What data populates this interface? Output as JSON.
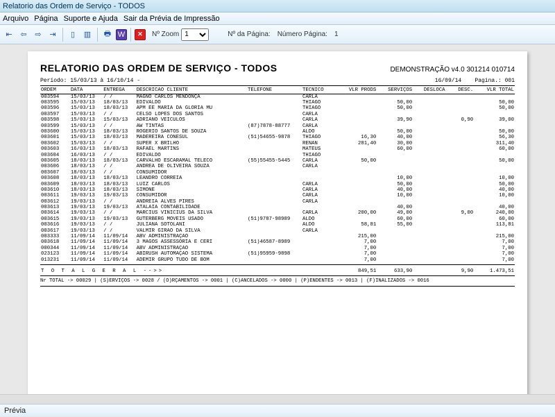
{
  "window": {
    "title": "Relatorio das Ordem de Serviço - TODOS"
  },
  "menu": {
    "items": [
      "Arquivo",
      "Página",
      "Suporte e Ajuda",
      "Sair da Prévia de Impressão"
    ]
  },
  "toolbar": {
    "zoom_label": "Nº Zoom",
    "zoom_value": "1",
    "page_label": "Nº da Página:",
    "page_field_label": "Número Página:",
    "page_value": "1"
  },
  "report": {
    "title": "RELATORIO DAS ORDEM DE SERVIÇO  - TODOS",
    "version": "DEMONSTRAÇÃO v4.0 301214 010714",
    "period_label": "Período: 15/03/13 à 16/10/14 -",
    "print_date": "16/09/14",
    "page_label": "Pagina.: 001",
    "columns": [
      "ORDEM",
      "DATA",
      "ENTREGA",
      "DESCRICAO CLIENTE",
      "TELEFONE",
      "TÉCNICO",
      "VLR PRODS",
      "SERVIÇOS",
      "DESLOCA",
      "DESC.",
      "VLR TOTAL"
    ],
    "rows": [
      {
        "ordem": "003594",
        "data": "15/03/13",
        "entrega": "  /  /",
        "cliente": "MAGNO CARLOS MENDONÇA",
        "telefone": "",
        "tecnico": "CARLA",
        "prods": "",
        "serv": "",
        "desl": "",
        "desc": "",
        "tot": ""
      },
      {
        "ordem": "003595",
        "data": "15/03/13",
        "entrega": "18/03/13",
        "cliente": "EDIVALDO",
        "telefone": "",
        "tecnico": "THIAGO",
        "prods": "",
        "serv": "50,00",
        "desl": "",
        "desc": "",
        "tot": "50,00"
      },
      {
        "ordem": "003596",
        "data": "15/03/13",
        "entrega": "18/03/13",
        "cliente": "APM EE MARIA DA GLORIA MU",
        "telefone": "",
        "tecnico": "THIAGO",
        "prods": "",
        "serv": "50,00",
        "desl": "",
        "desc": "",
        "tot": "50,00"
      },
      {
        "ordem": "003597",
        "data": "15/03/13",
        "entrega": "  /  /",
        "cliente": "CELSO LOPES DOS SANTOS",
        "telefone": "",
        "tecnico": "CARLA",
        "prods": "",
        "serv": "",
        "desl": "",
        "desc": "",
        "tot": ""
      },
      {
        "ordem": "003598",
        "data": "15/03/13",
        "entrega": "15/03/13",
        "cliente": "ADRIANO VEICULOS",
        "telefone": "",
        "tecnico": "CARLA",
        "prods": "",
        "serv": "39,90",
        "desl": "",
        "desc": "0,90",
        "tot": "39,00"
      },
      {
        "ordem": "003599",
        "data": "15/03/13",
        "entrega": "  /  /",
        "cliente": "AW TINTAS",
        "telefone": "(87)7878-88777",
        "tecnico": "CARLA",
        "prods": "",
        "serv": "",
        "desl": "",
        "desc": "",
        "tot": ""
      },
      {
        "ordem": "003600",
        "data": "15/03/13",
        "entrega": "18/03/13",
        "cliente": "ROGERIO SANTOS DE SOUZA",
        "telefone": "",
        "tecnico": "ALDO",
        "prods": "",
        "serv": "50,00",
        "desl": "",
        "desc": "",
        "tot": "50,00"
      },
      {
        "ordem": "003601",
        "data": "15/03/13",
        "entrega": "18/03/13",
        "cliente": "MADEREIRA  CONESUL",
        "telefone": "(51)54655-9878",
        "tecnico": "THIAGO",
        "prods": "16,30",
        "serv": "40,00",
        "desl": "",
        "desc": "",
        "tot": "56,30"
      },
      {
        "ordem": "003602",
        "data": "15/03/13",
        "entrega": "  /  /",
        "cliente": "SUPER X BRILHO",
        "telefone": "",
        "tecnico": "RENAN",
        "prods": "281,40",
        "serv": "30,00",
        "desl": "",
        "desc": "",
        "tot": "311,40"
      },
      {
        "ordem": "003603",
        "data": "16/03/13",
        "entrega": "18/03/13",
        "cliente": "RAFAEL MARTINS",
        "telefone": "",
        "tecnico": "MATEUS",
        "prods": "",
        "serv": "60,00",
        "desl": "",
        "desc": "",
        "tot": "60,00"
      },
      {
        "ordem": "003604",
        "data": "16/03/13",
        "entrega": "  /  /",
        "cliente": "EDIVALDO",
        "telefone": "",
        "tecnico": "THIAGO",
        "prods": "",
        "serv": "",
        "desl": "",
        "desc": "",
        "tot": ""
      },
      {
        "ordem": "003605",
        "data": "18/03/13",
        "entrega": "18/03/13",
        "cliente": "CARVALHO ESCARAMAL TELECO",
        "telefone": "(55)55455-5445",
        "tecnico": "CARLA",
        "prods": "50,00",
        "serv": "",
        "desl": "",
        "desc": "",
        "tot": "50,00"
      },
      {
        "ordem": "003606",
        "data": "18/03/13",
        "entrega": "  /  /",
        "cliente": "ANDREA DE OLIVEIRA SOUZA",
        "telefone": "",
        "tecnico": "CARLA",
        "prods": "",
        "serv": "",
        "desl": "",
        "desc": "",
        "tot": ""
      },
      {
        "ordem": "003607",
        "data": "18/03/13",
        "entrega": "  /  /",
        "cliente": "CONSUMIDOR",
        "telefone": "",
        "tecnico": "",
        "prods": "",
        "serv": "",
        "desl": "",
        "desc": "",
        "tot": ""
      },
      {
        "ordem": "003608",
        "data": "18/03/13",
        "entrega": "18/03/13",
        "cliente": "LEANDRO CORREIA",
        "telefone": "",
        "tecnico": "",
        "prods": "",
        "serv": "10,00",
        "desl": "",
        "desc": "",
        "tot": "10,00"
      },
      {
        "ordem": "003609",
        "data": "18/03/13",
        "entrega": "18/03/13",
        "cliente": "LUIZ CARLOS",
        "telefone": "",
        "tecnico": "CARLA",
        "prods": "",
        "serv": "50,00",
        "desl": "",
        "desc": "",
        "tot": "50,00"
      },
      {
        "ordem": "003610",
        "data": "18/03/13",
        "entrega": "18/03/13",
        "cliente": "SIMONE",
        "telefone": "",
        "tecnico": "CARLA",
        "prods": "",
        "serv": "40,00",
        "desl": "",
        "desc": "",
        "tot": "40,00"
      },
      {
        "ordem": "003611",
        "data": "19/03/13",
        "entrega": "19/03/13",
        "cliente": "CONSUMIDOR",
        "telefone": "",
        "tecnico": "CARLA",
        "prods": "",
        "serv": "10,00",
        "desl": "",
        "desc": "",
        "tot": "10,00"
      },
      {
        "ordem": "003612",
        "data": "19/03/13",
        "entrega": "  /  /",
        "cliente": "ANDREIA ALVES PIRES",
        "telefone": "",
        "tecnico": "CARLA",
        "prods": "",
        "serv": "",
        "desl": "",
        "desc": "",
        "tot": ""
      },
      {
        "ordem": "003613",
        "data": "19/03/13",
        "entrega": "19/03/13",
        "cliente": "ATALAIA CONTABILIDADE",
        "telefone": "",
        "tecnico": "",
        "prods": "",
        "serv": "40,00",
        "desl": "",
        "desc": "",
        "tot": "40,00"
      },
      {
        "ordem": "003614",
        "data": "19/03/13",
        "entrega": "  /  /",
        "cliente": "MARCIUS VINICIUS DA SILVA",
        "telefone": "",
        "tecnico": "CARLA",
        "prods": "200,00",
        "serv": "49,00",
        "desl": "",
        "desc": "9,00",
        "tot": "240,00"
      },
      {
        "ordem": "003615",
        "data": "19/03/13",
        "entrega": "19/03/13",
        "cliente": "GUTERBERG MOVEIS USADO",
        "telefone": "(51)9787-98989",
        "tecnico": "ALDO",
        "prods": "",
        "serv": "60,00",
        "desl": "",
        "desc": "",
        "tot": "60,00"
      },
      {
        "ordem": "003616",
        "data": "19/03/13",
        "entrega": "  /  /",
        "cliente": "JULIANA SOTOLANI",
        "telefone": "",
        "tecnico": "ALDO",
        "prods": "58,81",
        "serv": "55,00",
        "desl": "",
        "desc": "",
        "tot": "113,81"
      },
      {
        "ordem": "003617",
        "data": "19/03/13",
        "entrega": "  /  /",
        "cliente": "VALMIR GIRAO DA SILVA",
        "telefone": "",
        "tecnico": "CARLA",
        "prods": "",
        "serv": "",
        "desl": "",
        "desc": "",
        "tot": ""
      },
      {
        "ordem": "003333",
        "data": "11/09/14",
        "entrega": "11/09/14",
        "cliente": "ABV ADMINISTRAÇÃO",
        "telefone": "",
        "tecnico": "",
        "prods": "215,00",
        "serv": "",
        "desl": "",
        "desc": "",
        "tot": "215,00"
      },
      {
        "ordem": "003618",
        "data": "11/09/14",
        "entrega": "11/09/14",
        "cliente": "3 MAGOS ASSESSORIA E CERI",
        "telefone": "(51)46587-8989",
        "tecnico": "",
        "prods": "7,00",
        "serv": "",
        "desl": "",
        "desc": "",
        "tot": "7,00"
      },
      {
        "ordem": "000344",
        "data": "11/09/14",
        "entrega": "11/09/14",
        "cliente": "ABV ADMINISTRAÇÃO",
        "telefone": "",
        "tecnico": "",
        "prods": "7,00",
        "serv": "",
        "desl": "",
        "desc": "",
        "tot": "7,00"
      },
      {
        "ordem": "023123",
        "data": "11/09/14",
        "entrega": "11/09/14",
        "cliente": "ABIRUSH AUTOMAÇÃO SISTEMA",
        "telefone": "(51)95959-9898",
        "tecnico": "",
        "prods": "7,00",
        "serv": "",
        "desl": "",
        "desc": "",
        "tot": "7,00"
      },
      {
        "ordem": "013231",
        "data": "11/09/14",
        "entrega": "11/09/14",
        "cliente": "ADEMIR  GRUPO TUDO DE BOM",
        "telefone": "",
        "tecnico": "",
        "prods": "7,00",
        "serv": "",
        "desl": "",
        "desc": "",
        "tot": "7,00"
      }
    ],
    "total_label": "T O T A L  G E R A L   -->>",
    "totals": {
      "prods": "849,51",
      "serv": "633,90",
      "desl": "",
      "desc": "9,90",
      "tot": "1.473,51"
    },
    "footer": "Nr TOTAL -> 00029 | (S)ERVIÇOS -> 0028 / (O)RÇAMENTOS -> 0001 | (C)ANCELADOS -> 0000 | (P)ENDENTES -> 0013 | (F)INALIZADOS -> 0016"
  },
  "status": {
    "text": "Prévia"
  }
}
